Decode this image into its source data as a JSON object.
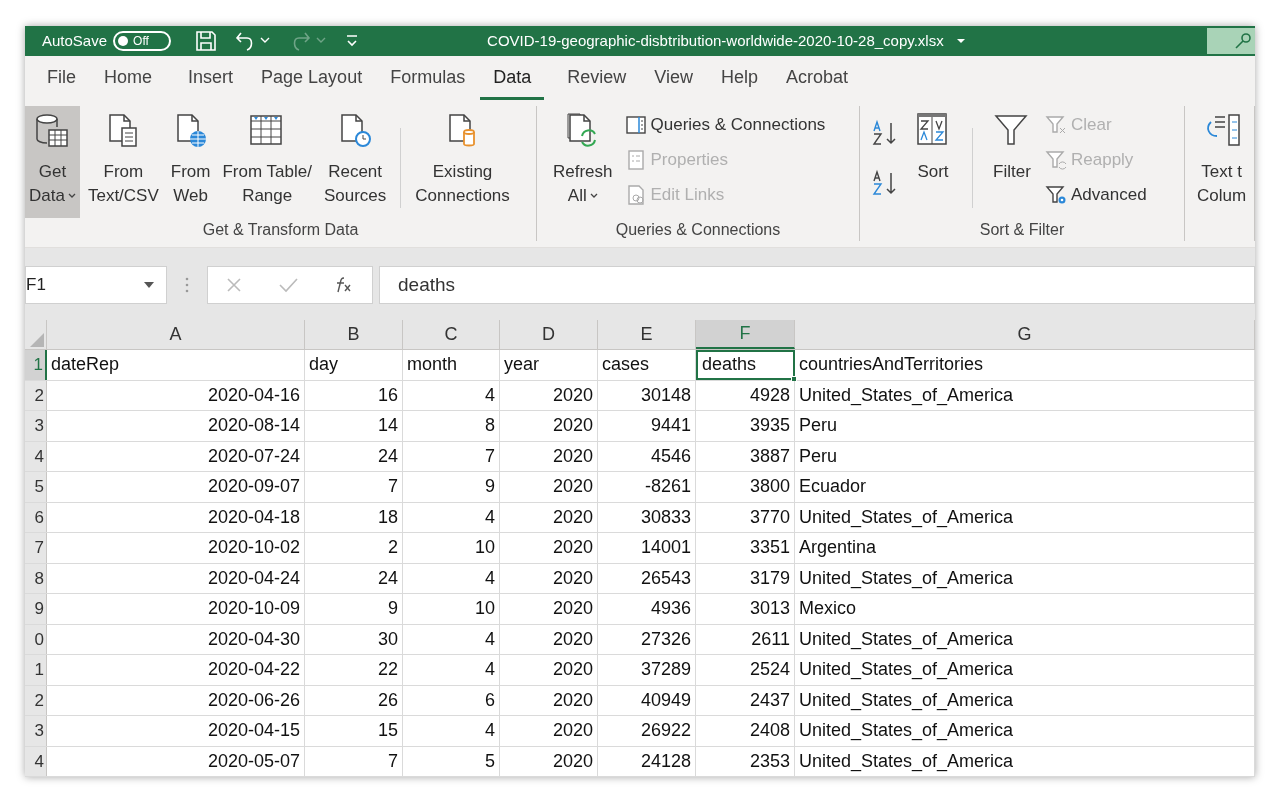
{
  "title_bar": {
    "autosave_label": "AutoSave",
    "autosave_toggle": {
      "label": "Off",
      "on": false
    },
    "file_name": "COVID-19-geographic-disbtribution-worldwide-2020-10-28_copy.xlsx",
    "redo_disabled": true
  },
  "tabs": [
    {
      "label": "File",
      "selected": false
    },
    {
      "label": "Home",
      "selected": false
    },
    {
      "label": "Insert",
      "selected": false
    },
    {
      "label": "Page Layout",
      "selected": false
    },
    {
      "label": "Formulas",
      "selected": false
    },
    {
      "label": "Data",
      "selected": true
    },
    {
      "label": "Review",
      "selected": false
    },
    {
      "label": "View",
      "selected": false
    },
    {
      "label": "Help",
      "selected": false
    },
    {
      "label": "Acrobat",
      "selected": false
    }
  ],
  "ribbon": {
    "groups": [
      {
        "label": "Get & Transform Data",
        "items": [
          {
            "kind": "large",
            "lines": [
              "Get",
              "Data"
            ],
            "dropdown": true,
            "highlighted": true
          },
          {
            "kind": "large",
            "lines": [
              "From",
              "Text/CSV"
            ],
            "dropdown": false,
            "highlighted": false
          },
          {
            "kind": "large",
            "lines": [
              "From",
              "Web"
            ],
            "dropdown": false,
            "highlighted": false
          },
          {
            "kind": "large",
            "lines": [
              "From Table/",
              "Range"
            ],
            "dropdown": false,
            "highlighted": false
          },
          {
            "kind": "large",
            "lines": [
              "Recent",
              "Sources"
            ],
            "dropdown": false,
            "highlighted": false
          },
          {
            "kind": "separator"
          },
          {
            "kind": "large",
            "lines": [
              "Existing",
              "Connections"
            ],
            "dropdown": false,
            "highlighted": false
          }
        ]
      },
      {
        "label": "Queries & Connections",
        "items": [
          {
            "kind": "large",
            "lines": [
              "Refresh",
              "All"
            ],
            "dropdown": true,
            "highlighted": false
          },
          {
            "kind": "stack",
            "entries": [
              {
                "label": "Queries & Connections",
                "disabled": false
              },
              {
                "label": "Properties",
                "disabled": true
              },
              {
                "label": "Edit Links",
                "disabled": true
              }
            ]
          }
        ]
      },
      {
        "label": "Sort & Filter",
        "items": [
          {
            "kind": "sortpair"
          },
          {
            "kind": "large",
            "lines": [
              "Sort"
            ],
            "dropdown": false,
            "highlighted": false
          },
          {
            "kind": "separator"
          },
          {
            "kind": "large",
            "lines": [
              "Filter"
            ],
            "dropdown": false,
            "highlighted": false
          },
          {
            "kind": "stack",
            "entries": [
              {
                "label": "Clear",
                "disabled": true
              },
              {
                "label": "Reapply",
                "disabled": true
              },
              {
                "label": "Advanced",
                "disabled": false
              }
            ]
          }
        ]
      },
      {
        "items": [
          {
            "kind": "large",
            "lines": [
              "Text t",
              "Colum"
            ],
            "dropdown": false,
            "highlighted": false
          }
        ]
      }
    ]
  },
  "formula_bar": {
    "name_box": "F1",
    "formula": "deaths"
  },
  "sheet": {
    "columns": [
      {
        "letter": "A",
        "numeric": true,
        "selected": false
      },
      {
        "letter": "B",
        "numeric": true,
        "selected": false
      },
      {
        "letter": "C",
        "numeric": true,
        "selected": false
      },
      {
        "letter": "D",
        "numeric": true,
        "selected": false
      },
      {
        "letter": "E",
        "numeric": true,
        "selected": false
      },
      {
        "letter": "F",
        "numeric": true,
        "selected": true
      },
      {
        "letter": "G",
        "numeric": false,
        "selected": false
      }
    ],
    "rows": [
      {
        "number": "1",
        "kind": "header",
        "selected": true,
        "cells": [
          "dateRep",
          "day",
          "month",
          "year",
          "cases",
          "deaths",
          "countriesAndTerritories"
        ]
      },
      {
        "number": "2",
        "kind": "data",
        "selected": false,
        "cells": [
          "2020-04-16",
          "16",
          "4",
          "2020",
          "30148",
          "4928",
          "United_States_of_America"
        ]
      },
      {
        "number": "3",
        "kind": "data",
        "selected": false,
        "cells": [
          "2020-08-14",
          "14",
          "8",
          "2020",
          "9441",
          "3935",
          "Peru"
        ]
      },
      {
        "number": "4",
        "kind": "data",
        "selected": false,
        "cells": [
          "2020-07-24",
          "24",
          "7",
          "2020",
          "4546",
          "3887",
          "Peru"
        ]
      },
      {
        "number": "5",
        "kind": "data",
        "selected": false,
        "cells": [
          "2020-09-07",
          "7",
          "9",
          "2020",
          "-8261",
          "3800",
          "Ecuador"
        ]
      },
      {
        "number": "6",
        "kind": "data",
        "selected": false,
        "cells": [
          "2020-04-18",
          "18",
          "4",
          "2020",
          "30833",
          "3770",
          "United_States_of_America"
        ]
      },
      {
        "number": "7",
        "kind": "data",
        "selected": false,
        "cells": [
          "2020-10-02",
          "2",
          "10",
          "2020",
          "14001",
          "3351",
          "Argentina"
        ]
      },
      {
        "number": "8",
        "kind": "data",
        "selected": false,
        "cells": [
          "2020-04-24",
          "24",
          "4",
          "2020",
          "26543",
          "3179",
          "United_States_of_America"
        ]
      },
      {
        "number": "9",
        "kind": "data",
        "selected": false,
        "cells": [
          "2020-10-09",
          "9",
          "10",
          "2020",
          "4936",
          "3013",
          "Mexico"
        ]
      },
      {
        "number": "0",
        "kind": "data",
        "selected": false,
        "cells": [
          "2020-04-30",
          "30",
          "4",
          "2020",
          "27326",
          "2611",
          "United_States_of_America"
        ]
      },
      {
        "number": "1",
        "kind": "data",
        "selected": false,
        "cells": [
          "2020-04-22",
          "22",
          "4",
          "2020",
          "37289",
          "2524",
          "United_States_of_America"
        ]
      },
      {
        "number": "2",
        "kind": "data",
        "selected": false,
        "cells": [
          "2020-06-26",
          "26",
          "6",
          "2020",
          "40949",
          "2437",
          "United_States_of_America"
        ]
      },
      {
        "number": "3",
        "kind": "data",
        "selected": false,
        "cells": [
          "2020-04-15",
          "15",
          "4",
          "2020",
          "26922",
          "2408",
          "United_States_of_America"
        ]
      },
      {
        "number": "4",
        "kind": "data",
        "selected": false,
        "cells": [
          "2020-05-07",
          "7",
          "5",
          "2020",
          "24128",
          "2353",
          "United_States_of_America"
        ]
      }
    ]
  }
}
